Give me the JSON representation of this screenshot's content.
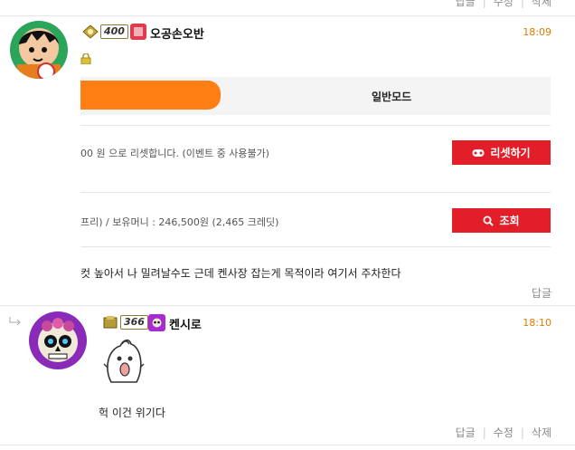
{
  "top_actions": [
    "답글",
    "수정",
    "삭제"
  ],
  "comment1": {
    "level": "400",
    "nickname": "오공손오반",
    "time": "18:09",
    "mode_tabs": {
      "inactive_label": "일반모드"
    },
    "panel_row1_text": "00 원 으로 리셋합니다. (이벤트 중 사용불가)",
    "reset_button": "리셋하기",
    "panel_row2_text": "프리) / 보유머니 : 246,500원 (2,465 크레딧)",
    "search_button": "조회",
    "text": "컷 높아서 나 밀려날수도 근데 켄사장 잡는게 목적이라 여기서 주차한다",
    "reply": "답글"
  },
  "comment2": {
    "level": "366",
    "nickname": "켄시로",
    "time": "18:10",
    "text": "헉 이건 위기다",
    "actions": [
      "답글",
      "수정",
      "삭제"
    ]
  },
  "colors": {
    "accent_orange": "#ff7f14",
    "button_red": "#e21f28",
    "time_orange": "#e07a00"
  }
}
